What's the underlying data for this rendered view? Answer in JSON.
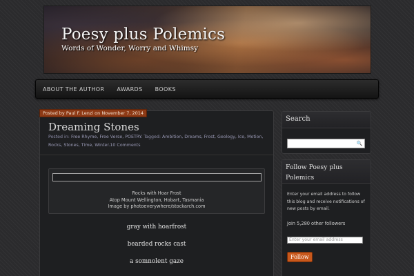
{
  "header": {
    "title": "Poesy plus Polemics",
    "tagline": "Words of Wonder, Worry and Whimsy"
  },
  "nav": {
    "items": [
      "ABOUT THE AUTHOR",
      "AWARDS",
      "BOOKS"
    ]
  },
  "post": {
    "meta": "Posted by Paul F. Lenzi on November 7, 2014",
    "title": "Dreaming Stones",
    "posted_in_label": "Posted in:",
    "categories": "Free Rhyme, Free Verse, POETRY.",
    "tagged_label": "Tagged:",
    "tags": "Ambition, Dreams, Frost, Geology, Ice, Motion, Rocks, Stones, Time, Winter.",
    "comments": "10 Comments",
    "figure": {
      "caption_line1": "Rocks with Hoar Frost",
      "caption_line2": "Atop Mount Wellington, Hobart, Tasmania",
      "caption_line3": "Image by photoeverywhere/stockarch.com"
    },
    "poem": [
      "gray with hoarfrost",
      "bearded rocks cast",
      "a somnolent gaze"
    ]
  },
  "sidebar": {
    "search": {
      "title": "Search",
      "icon": "search-icon"
    },
    "follow": {
      "title": "Follow Poesy plus Polemics",
      "description": "Enter your email address to follow this blog and receive notifications of new posts by email.",
      "followers": "Join 5,280 other followers",
      "email_placeholder": "Enter your email address",
      "button_label": "Follow"
    }
  },
  "colors": {
    "accent": "#c8581c",
    "meta_bar": "#8e3a15",
    "background": "#2b2b2d"
  }
}
